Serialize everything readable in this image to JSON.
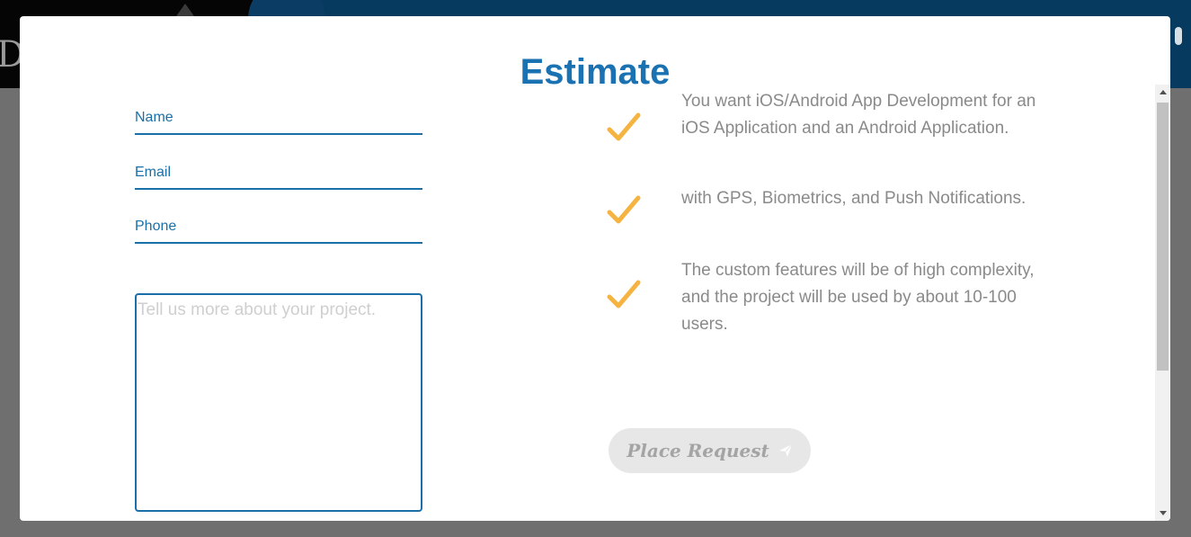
{
  "modal": {
    "title": "Estimate"
  },
  "form": {
    "name_label": "Name",
    "email_label": "Email",
    "phone_label": "Phone",
    "project_placeholder": "Tell us more about your project."
  },
  "summary": {
    "items": [
      {
        "text": "You want iOS/Android App Development for an iOS Application and an Android Application.",
        "icon": "checkmark-icon"
      },
      {
        "text": "with GPS, Biometrics, and Push Notifications.",
        "icon": "checkmark-icon"
      },
      {
        "text": "The custom features will be of high complexity, and the project will be used by about 10-100 users.",
        "icon": "checkmark-icon"
      }
    ]
  },
  "submit": {
    "label": "Place Request",
    "icon": "send-icon"
  },
  "colors": {
    "accent": "#1a72b3",
    "check": "#f5b342",
    "text_muted": "#8a8a8a",
    "button_bg": "#e7e7e7"
  }
}
